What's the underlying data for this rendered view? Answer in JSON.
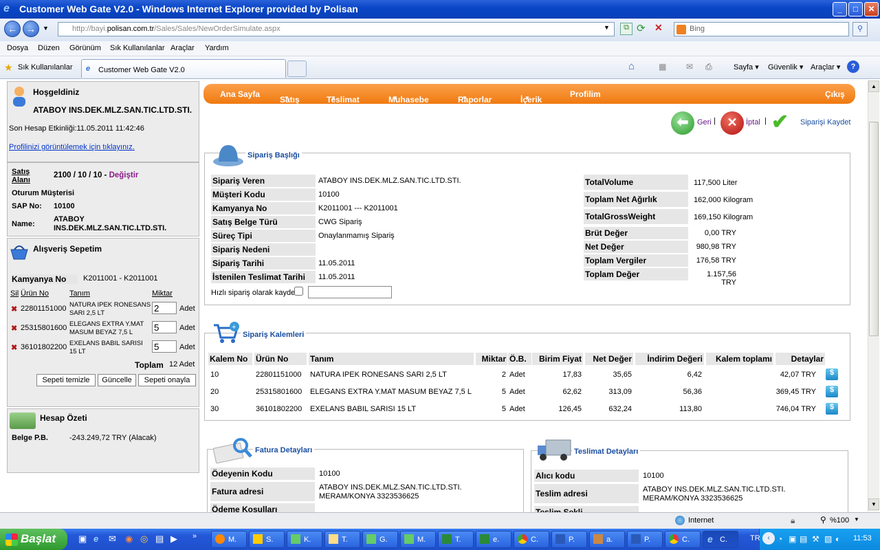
{
  "window": {
    "title": "Customer Web Gate V2.0 - Windows Internet Explorer provided by Polisan"
  },
  "address": {
    "url_prefix": "http://bayi.",
    "url_host": "polisan.com.tr",
    "url_path": "/Sales/Sales/NewOrderSimulate.aspx",
    "search_placeholder": "Bing"
  },
  "menu": [
    "Dosya",
    "Düzen",
    "Görünüm",
    "Sık Kullanılanlar",
    "Araçlar",
    "Yardım"
  ],
  "favbar": {
    "favorites": "Sık Kullanılanlar",
    "tab_title": "Customer Web Gate V2.0",
    "tools": [
      "Sayfa",
      "Güvenlik",
      "Araçlar"
    ]
  },
  "welcome": {
    "title": "Hoşgeldiniz",
    "company": "ATABOY INS.DEK.MLZ.SAN.TIC.LTD.STI.",
    "last_activity": "Son Hesap Etkinliği:11.05.2011 11:42:46",
    "profile_link": "Profilinizi görüntülemek için tıklayınız."
  },
  "session": {
    "sales_area_label": "Satış Alanı",
    "sales_area": "2100 / 10 / 10",
    "change": "Değiştir",
    "customer_title": "Oturum Müşterisi",
    "sap_label": "SAP No:",
    "sap_no": "10100",
    "name_label": "Name:",
    "name": "ATABOY INS.DEK.MLZ.SAN.TIC.LTD.STI."
  },
  "cart": {
    "title": "Alışveriş Sepetim",
    "campaign_label": "Kamyanya No",
    "campaign": "K2011001 - K2011001",
    "headers": [
      "Sil",
      "Ürün No",
      "Tanım",
      "Miktar"
    ],
    "items": [
      {
        "no": "22801151000",
        "desc": "NATURA IPEK RONESANS SARI 2,5 LT",
        "qty": "2",
        "unit": "Adet"
      },
      {
        "no": "25315801600",
        "desc": "ELEGANS EXTRA Y.MAT MASUM BEYAZ 7,5 L",
        "qty": "5",
        "unit": "Adet"
      },
      {
        "no": "36101802200",
        "desc": "EXELANS BABIL SARISI 15 LT",
        "qty": "5",
        "unit": "Adet"
      }
    ],
    "total_label": "Toplam",
    "total": "12 Adet",
    "buttons": [
      "Sepeti temizle",
      "Güncelle",
      "Sepeti onayla"
    ]
  },
  "account": {
    "title": "Hesap Özeti",
    "label": "Belge P.B.",
    "value": "-243.249,72 TRY (Alacak)"
  },
  "nav": [
    "Ana Sayfa",
    "Satış",
    "Teslimat",
    "Muhasebe",
    "Raporlar",
    "İçerik",
    "Profilim",
    "Çıkış"
  ],
  "actions": {
    "back": "Geri",
    "cancel": "İptal",
    "save": "Siparişi Kaydet"
  },
  "header_section": {
    "title": "Sipariş Başlığı",
    "left": [
      {
        "label": "Sipariş Veren",
        "value": "ATABOY INS.DEK.MLZ.SAN.TIC.LTD.STI."
      },
      {
        "label": "Müşteri Kodu",
        "value": "10100"
      },
      {
        "label": "Kamyanya No",
        "value": "K2011001 --- K2011001"
      },
      {
        "label": "Satış Belge Türü",
        "value": "CWG Sipariş"
      },
      {
        "label": "Süreç Tipi",
        "value": "Onaylanmamış Sipariş"
      },
      {
        "label": "Sipariş Nedeni",
        "value": ""
      },
      {
        "label": "Sipariş Tarihi",
        "value": "11.05.2011"
      },
      {
        "label": "İstenilen Teslimat Tarihi",
        "value": "11.05.2011"
      }
    ],
    "quick_save": "Hızlı sipariş olarak kaydet",
    "right": [
      {
        "label": "TotalVolume",
        "value": "117,500 Liter"
      },
      {
        "label": "Toplam Net Ağırlık",
        "value": "162,000 Kilogram"
      },
      {
        "label": "TotalGrossWeight",
        "value": "169,150 Kilogram"
      },
      {
        "label": "Brüt Değer",
        "value": "0,00 TRY"
      },
      {
        "label": "Net Değer",
        "value": "980,98 TRY"
      },
      {
        "label": "Toplam Vergiler",
        "value": "176,58 TRY"
      },
      {
        "label": "Toplam Değer",
        "value": "1.157,56 TRY"
      }
    ]
  },
  "lines_section": {
    "title": "Sipariş Kalemleri",
    "headers": [
      "Kalem No",
      "Ürün No",
      "Tanım",
      "Miktar",
      "Ö.B.",
      "Birim Fiyat",
      "Net Değer",
      "İndirim Değeri",
      "Kalem toplamı",
      "Detaylar"
    ],
    "rows": [
      [
        "10",
        "22801151000",
        "NATURA IPEK RONESANS SARI 2,5 LT",
        "2",
        "Adet",
        "17,83",
        "35,65",
        "6,42",
        "42,07 TRY"
      ],
      [
        "20",
        "25315801600",
        "ELEGANS EXTRA Y.MAT MASUM BEYAZ 7,5 L",
        "5",
        "Adet",
        "62,62",
        "313,09",
        "56,36",
        "369,45 TRY"
      ],
      [
        "30",
        "36101802200",
        "EXELANS BABIL SARISI 15 LT",
        "5",
        "Adet",
        "126,45",
        "632,24",
        "113,80",
        "746,04 TRY"
      ]
    ]
  },
  "invoice": {
    "title": "Fatura Detayları",
    "rows": [
      {
        "label": "Ödeyenin Kodu",
        "value": "10100"
      },
      {
        "label": "Fatura adresi",
        "value": "ATABOY INS.DEK.MLZ.SAN.TIC.LTD.STI. MERAM/KONYA 3323536625"
      },
      {
        "label": "Ödeme Koşulları",
        "value": ""
      }
    ]
  },
  "delivery": {
    "title": "Teslimat Detayları",
    "rows": [
      {
        "label": "Alıcı kodu",
        "value": "10100"
      },
      {
        "label": "Teslim adresi",
        "value": "ATABOY INS.DEK.MLZ.SAN.TIC.LTD.STI. MERAM/KONYA 3323536625"
      },
      {
        "label": "Teslim Şekli",
        "value": ""
      }
    ]
  },
  "status": {
    "zone": "Internet",
    "zoom": "%100"
  },
  "taskbar": {
    "start": "Başlat",
    "items": [
      "M.",
      "S.",
      "K.",
      "T.",
      "G.",
      "M.",
      "T.",
      "e.",
      "C.",
      "P.",
      "a.",
      "P.",
      "C.",
      "C."
    ],
    "lang": "TR",
    "clock": "11:53"
  }
}
